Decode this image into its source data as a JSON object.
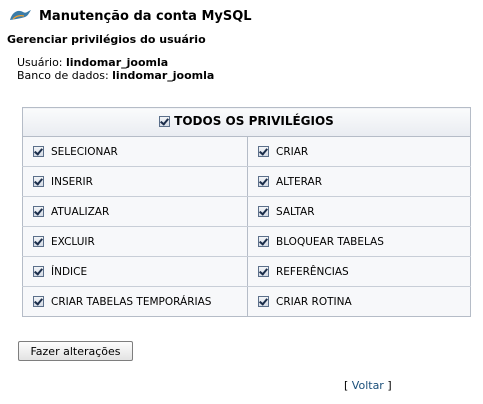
{
  "header": {
    "title": "Manutenção da conta MySQL",
    "logo_text": "MySQL"
  },
  "subtitle": "Gerenciar privilégios do usuário",
  "info": {
    "user_label": "Usuário:",
    "user_value": "lindomar_joomla",
    "db_label": "Banco de dados:",
    "db_value": "lindomar_joomla"
  },
  "privileges": {
    "all_label": "TODOS OS PRIVILÉGIOS",
    "all_checked": true,
    "rows": [
      {
        "left": "SELECIONAR",
        "right": "CRIAR"
      },
      {
        "left": "INSERIR",
        "right": "ALTERAR"
      },
      {
        "left": "ATUALIZAR",
        "right": "SALTAR"
      },
      {
        "left": "EXCLUIR",
        "right": "BLOQUEAR TABELAS"
      },
      {
        "left": "ÍNDICE",
        "right": "REFERÊNCIAS"
      },
      {
        "left": "CRIAR TABELAS TEMPORÁRIAS",
        "right": "CRIAR ROTINA"
      }
    ]
  },
  "actions": {
    "submit_label": "Fazer alterações",
    "back_open": "[",
    "back_label": "Voltar",
    "back_close": "]"
  },
  "colors": {
    "link": "#1a4f7a",
    "table_border": "#b5bcc7",
    "table_bg": "#f7f8fa"
  }
}
